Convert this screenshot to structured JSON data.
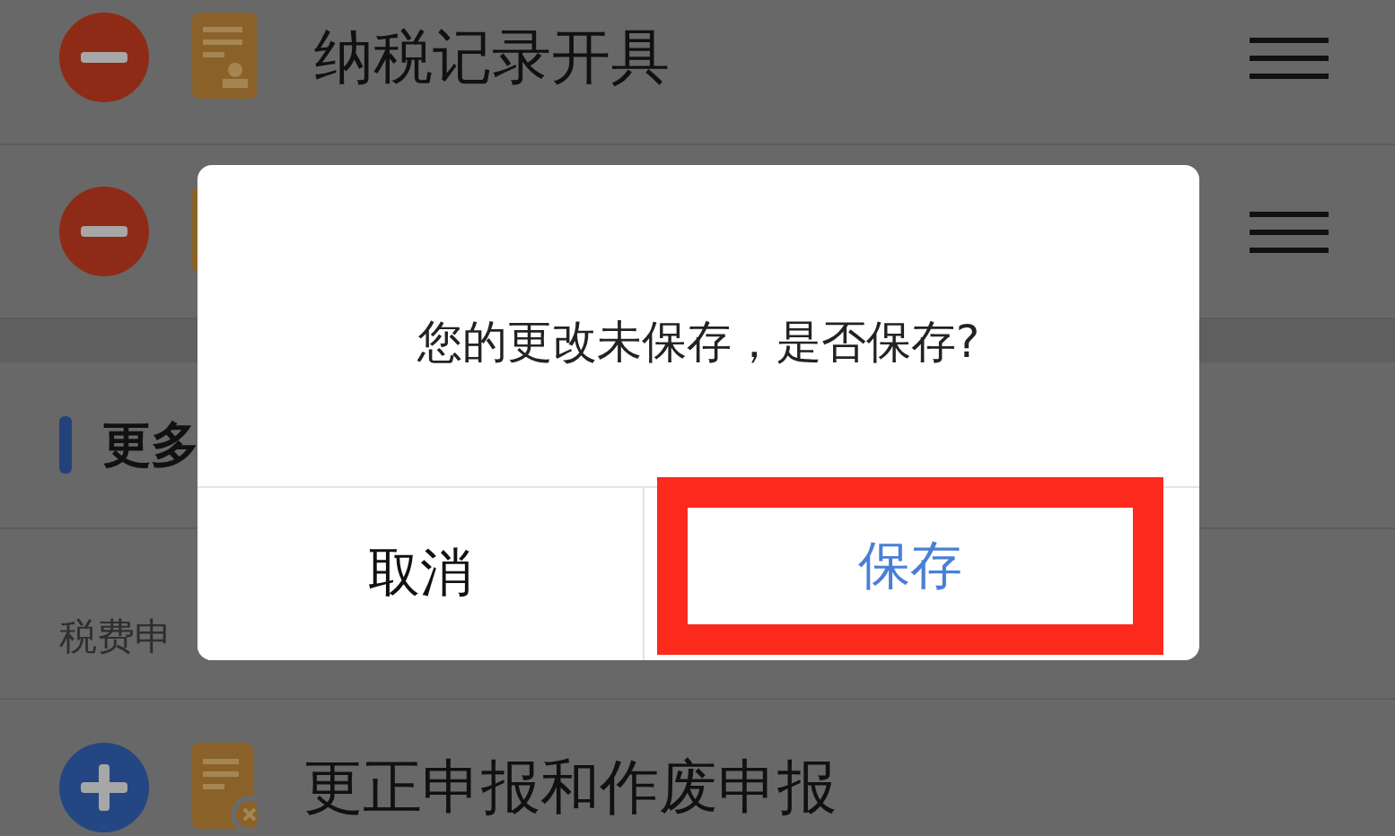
{
  "edit_list": [
    {
      "kind": "remove",
      "title": "纳税记录开具"
    },
    {
      "kind": "remove"
    }
  ],
  "more_section": {
    "heading": "更多",
    "subheading": "税费申",
    "items": [
      {
        "kind": "add",
        "title": "更正申报和作废申报"
      }
    ]
  },
  "dialog": {
    "message": "您的更改未保存，是否保存?",
    "buttons": [
      {
        "kind": "cancel",
        "label": "取消",
        "highlighted": false
      },
      {
        "kind": "confirm",
        "label": "保存",
        "highlighted": true
      }
    ]
  }
}
